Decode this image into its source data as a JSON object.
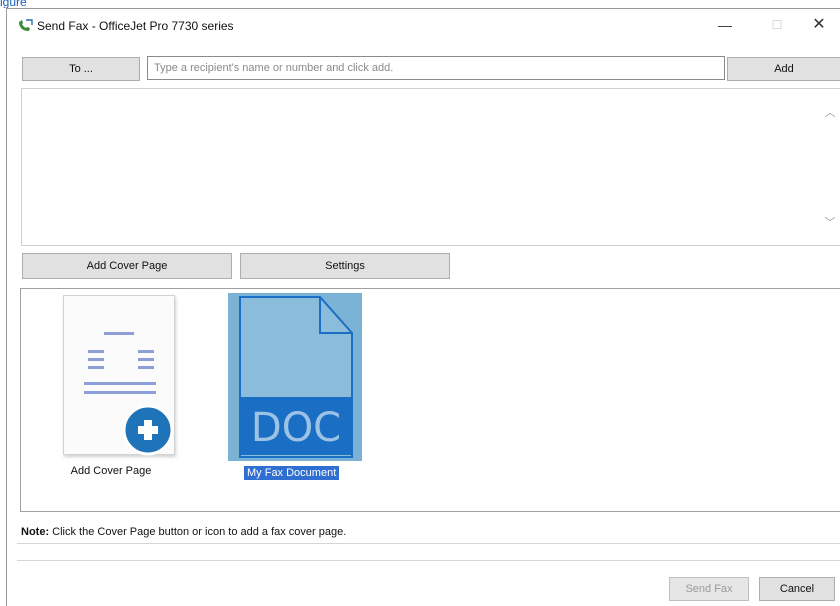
{
  "top_fragment": "igure",
  "window": {
    "title": "Send Fax - OfficeJet Pro 7730 series",
    "controls": {
      "minimize": "—",
      "maximize": "☐",
      "close": "✕"
    }
  },
  "recipient": {
    "to_label": "To ...",
    "input_placeholder": "Type a recipient's name or number and click add.",
    "input_value": "",
    "add_label": "Add"
  },
  "actions": {
    "add_cover_page_label": "Add Cover Page",
    "settings_label": "Settings"
  },
  "documents": [
    {
      "name": "Add Cover Page",
      "icon": "cover-page-add-icon",
      "selected": false
    },
    {
      "name": "My Fax Document",
      "icon": "doc-file-icon",
      "badge": "DOC",
      "selected": true
    }
  ],
  "note": {
    "prefix": "Note:",
    "text": " Click the Cover Page button or icon to add a fax cover page."
  },
  "footer": {
    "send_label": "Send Fax",
    "send_enabled": false,
    "cancel_label": "Cancel"
  },
  "colors": {
    "selection_bg": "#2f6fd1",
    "doc_tile": "#7bb3d6",
    "doc_band": "#1a6fc4",
    "plus_badge": "#1f73b8"
  }
}
